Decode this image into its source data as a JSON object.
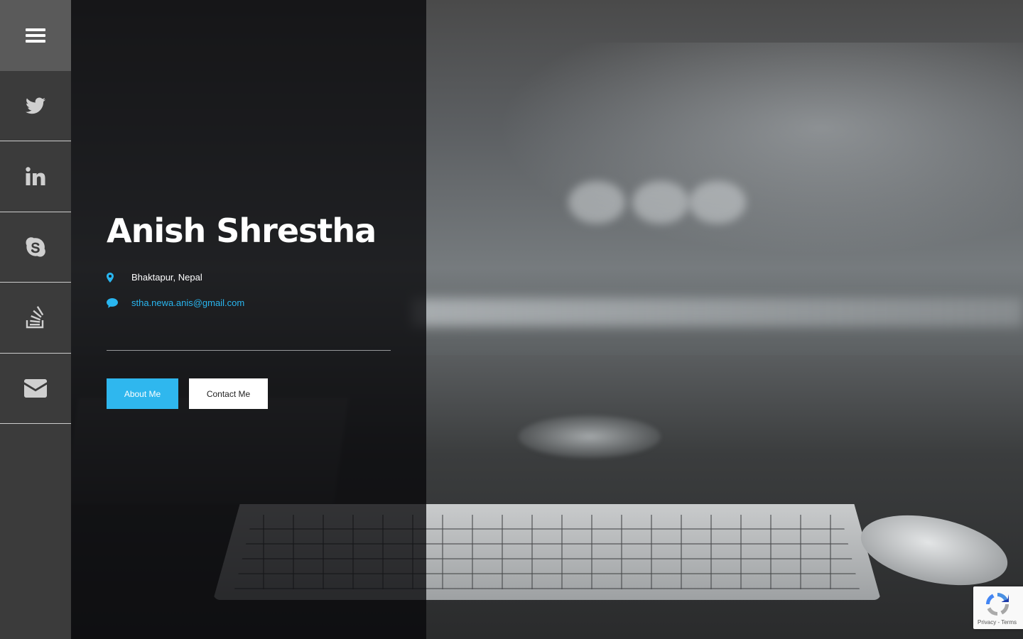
{
  "sidebar": {
    "items": [
      {
        "icon": "menu-icon"
      },
      {
        "icon": "twitter-icon"
      },
      {
        "icon": "linkedin-icon"
      },
      {
        "icon": "skype-icon"
      },
      {
        "icon": "stack-overflow-icon"
      },
      {
        "icon": "envelope-icon"
      }
    ]
  },
  "profile": {
    "name": "Anish Shrestha",
    "location": "Bhaktapur, Nepal",
    "email": "stha.newa.anis@gmail.com",
    "location_icon": "map-marker-icon",
    "email_icon": "comment-icon"
  },
  "buttons": {
    "about_label": "About Me",
    "contact_label": "Contact Me"
  },
  "recaptcha": {
    "privacy": "Privacy",
    "separator": "-",
    "terms": "Terms"
  },
  "colors": {
    "accent": "#2fb7ee",
    "sidebar": "#3b3b3b",
    "sidebar_active": "#5a5a5a",
    "panel": "#0d0d0f"
  }
}
